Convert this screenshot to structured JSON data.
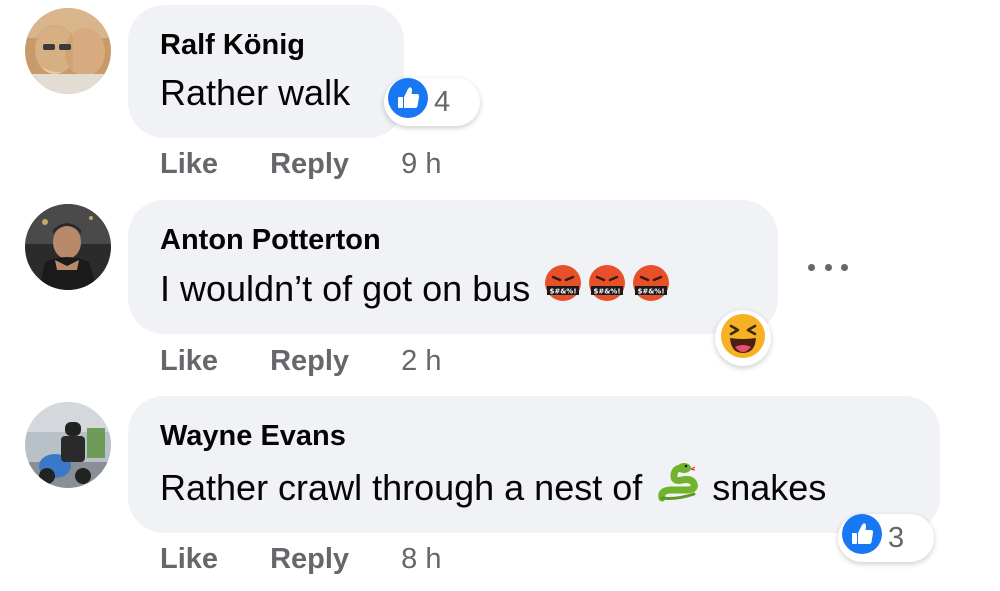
{
  "comments": [
    {
      "author": "Ralf König",
      "text": "Rather walk",
      "reaction_icon": "like-icon",
      "reaction_count": "4",
      "like_label": "Like",
      "reply_label": "Reply",
      "time": "9 h"
    },
    {
      "author": "Anton Potterton",
      "text": "I wouldn’t of got on bus",
      "inline_emojis": [
        "cursing-face-emoji",
        "cursing-face-emoji",
        "cursing-face-emoji"
      ],
      "reaction_icon": "haha-icon",
      "like_label": "Like",
      "reply_label": "Reply",
      "time": "2 h",
      "more_icon": "more-options-icon"
    },
    {
      "author": "Wayne Evans",
      "text_before": "Rather crawl through a nest of",
      "inline_emoji": "snake-emoji",
      "text_after": "snakes",
      "reaction_icon": "like-icon",
      "reaction_count": "3",
      "like_label": "Like",
      "reply_label": "Reply",
      "time": "8 h"
    }
  ],
  "colors": {
    "bubble": "#f0f2f5",
    "secondary_text": "#65676b",
    "like_blue": "#1877f2",
    "haha_yellow": "#f7b125"
  }
}
